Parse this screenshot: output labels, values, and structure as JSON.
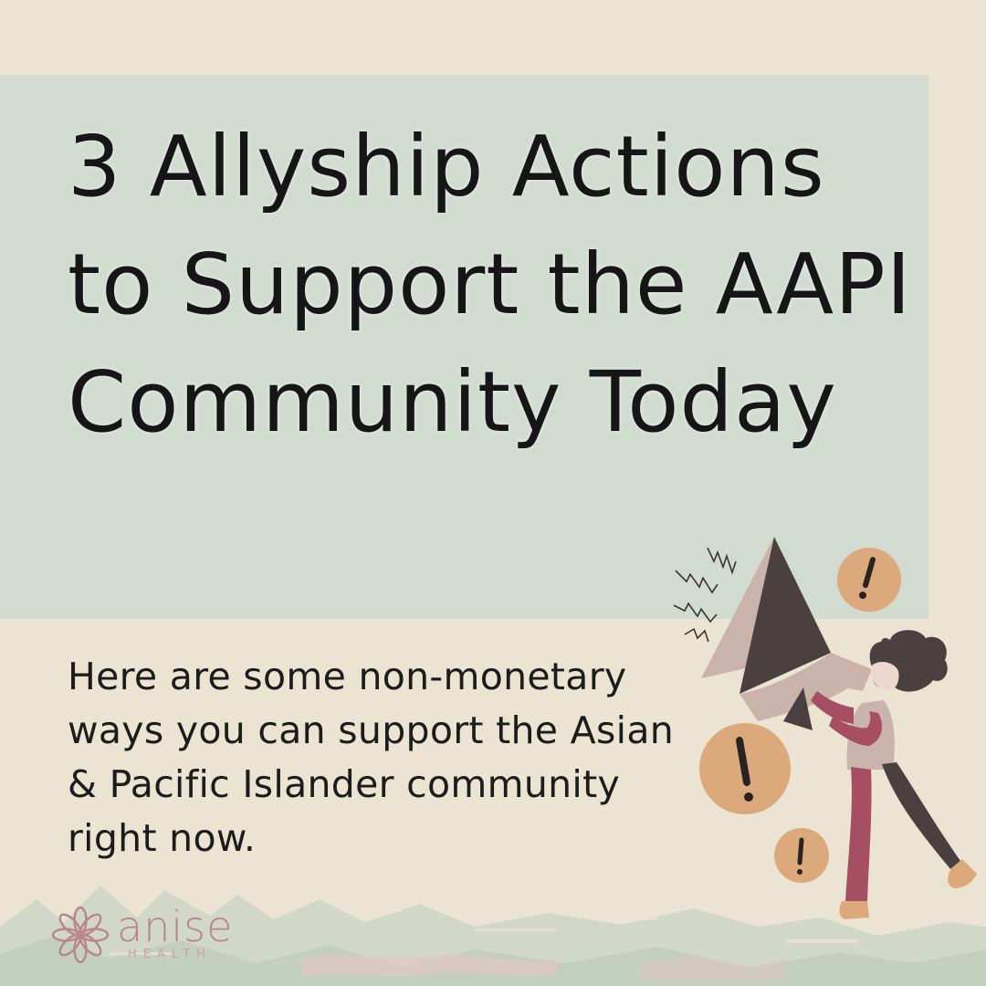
{
  "title": "3 Allyship Actions to Support the AAPI Community Today",
  "body": "Here are some non-monetary ways you can support the Asian & Pacific Islander community right now.",
  "logo": {
    "name": "anise",
    "sub": "HEALTH"
  },
  "colors": {
    "background": "#ece4d2",
    "title_box": "#d1dbd0",
    "text": "#161616",
    "brand": "#b9868f",
    "accent_circle": "#dba97b"
  },
  "illustration": {
    "icon": "megaphone-person-illustration",
    "badge_icon": "exclamation-icon"
  }
}
